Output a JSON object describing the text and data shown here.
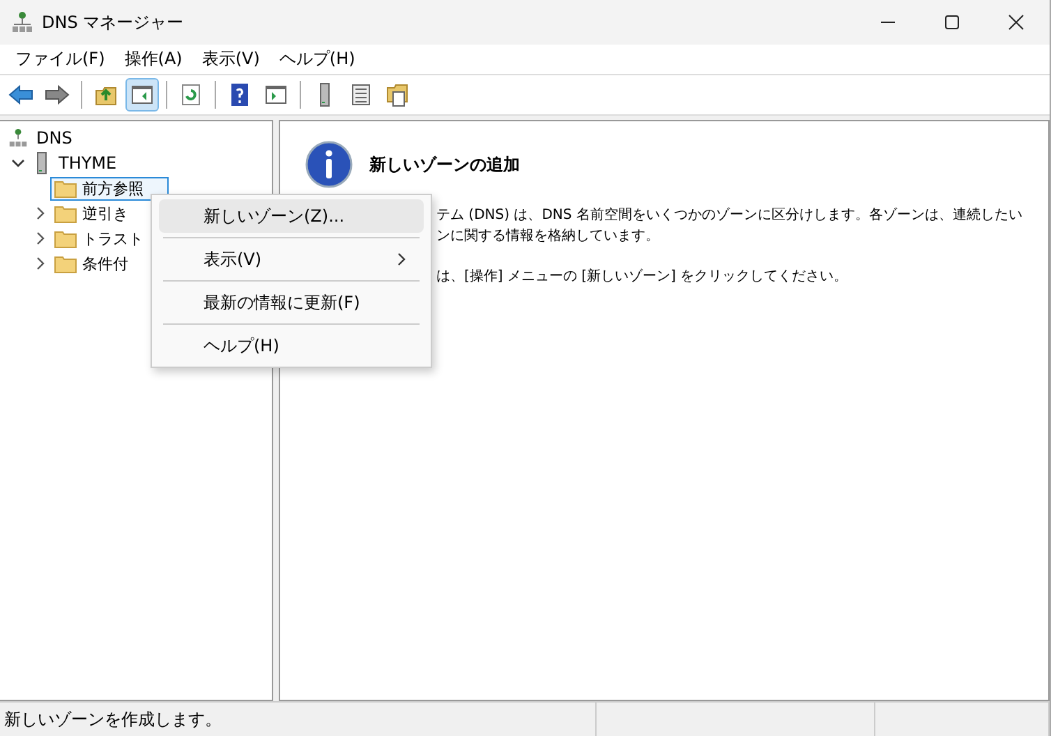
{
  "window": {
    "title": "DNS マネージャー"
  },
  "menu_bar": [
    "ファイル(F)",
    "操作(A)",
    "表示(V)",
    "ヘルプ(H)"
  ],
  "toolbar": [
    {
      "kind": "back",
      "pressed": false
    },
    {
      "kind": "forward",
      "pressed": false
    },
    {
      "kind": "sep"
    },
    {
      "kind": "up",
      "pressed": false
    },
    {
      "kind": "tree",
      "pressed": true
    },
    {
      "kind": "sep"
    },
    {
      "kind": "refresh",
      "pressed": false
    },
    {
      "kind": "sep"
    },
    {
      "kind": "help",
      "pressed": false
    },
    {
      "kind": "pane",
      "pressed": false
    },
    {
      "kind": "sep"
    },
    {
      "kind": "server",
      "pressed": false
    },
    {
      "kind": "list",
      "pressed": false
    },
    {
      "kind": "props",
      "pressed": false
    }
  ],
  "tree": {
    "label": "DNS",
    "children": [
      {
        "label": "THYME",
        "expanded": true,
        "children": [
          {
            "label": "前方参照",
            "selected": true,
            "has_children": false
          },
          {
            "label": "逆引き",
            "selected": false,
            "has_children": true
          },
          {
            "label": "トラスト",
            "selected": false,
            "has_children": true
          },
          {
            "label": "条件付",
            "selected": false,
            "has_children": true
          }
        ]
      }
    ]
  },
  "context_menu": [
    {
      "label": "新しいゾーン(Z)...",
      "highlighted": true,
      "submenu": false
    },
    {
      "label": "表示(V)",
      "highlighted": false,
      "submenu": true
    },
    {
      "label": "最新の情報に更新(F)",
      "highlighted": false,
      "submenu": false
    },
    {
      "label": "ヘルプ(H)",
      "highlighted": false,
      "submenu": false
    }
  ],
  "details": {
    "heading": "新しいゾーンの追加",
    "paragraphs": [
      [
        "テム (DNS) は、DNS 名前空間をいくつかのゾーンに区分けします。各ゾーンは、連続したい",
        "ンに関する情報を格納しています。"
      ],
      [
        "は、[操作] メニューの [新しいゾーン] をクリックしてください。"
      ]
    ]
  },
  "status_bar": [
    "新しいゾーンを作成します。"
  ]
}
